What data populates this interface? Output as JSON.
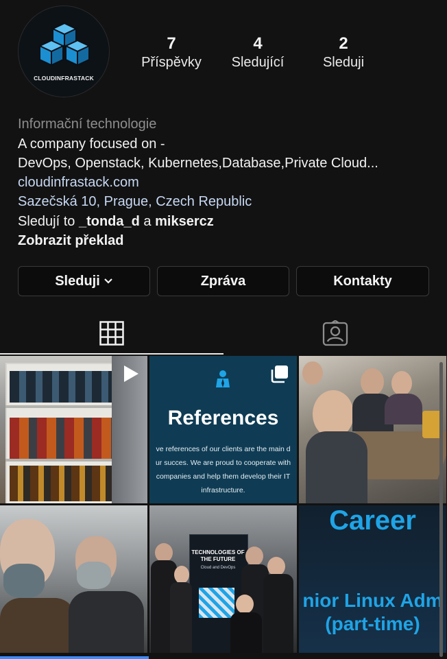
{
  "profile": {
    "avatar_text": "CLOUDINFRASTACK",
    "stats": [
      {
        "value": "7",
        "label": "Příspěvky"
      },
      {
        "value": "4",
        "label": "Sledující"
      },
      {
        "value": "2",
        "label": "Sleduji"
      }
    ],
    "category": "Informační technologie",
    "bio_line1": "A company focused on -",
    "bio_line2": "DevOps, Openstack, Kubernetes,Database,Private Cloud...",
    "website": "cloudinfrastack.com",
    "address": "Sazečská 10, Prague, Czech Republic",
    "followed_by_prefix": "Sledují to",
    "followed_by_user1": "_tonda_d",
    "followed_by_and": "a",
    "followed_by_user2": "miksercz",
    "translate": "Zobrazit překlad"
  },
  "actions": {
    "follow_label": "Sleduji",
    "message_label": "Zpráva",
    "contacts_label": "Kontakty"
  },
  "tabs": [
    {
      "icon": "grid-icon",
      "active": true
    },
    {
      "icon": "tagged-person-icon",
      "active": false
    }
  ],
  "posts": [
    {
      "kind": "photo",
      "overlay_icon": "video-play-icon"
    },
    {
      "kind": "graphic",
      "overlay_icon": "carousel-icon",
      "title": "References",
      "lines": [
        "ve references of our clients are the main d",
        "ur succes. We are proud to cooperate with",
        "companies and help them develop their IT",
        "infrastructure."
      ]
    },
    {
      "kind": "photo"
    },
    {
      "kind": "photo"
    },
    {
      "kind": "photo",
      "banner_title": "TECHNOLOGIES OF THE FUTURE",
      "banner_subtitle": "Cloud and DevOps"
    },
    {
      "kind": "graphic",
      "title": "Career",
      "line1": "nior Linux Adm",
      "line2": "(part-time)"
    }
  ],
  "colors": {
    "background": "#121212",
    "accent_blue": "#1fa4e6",
    "link": "#c7d8f3",
    "references_bg": "#0f3c54",
    "career_bg": "#14263a"
  }
}
